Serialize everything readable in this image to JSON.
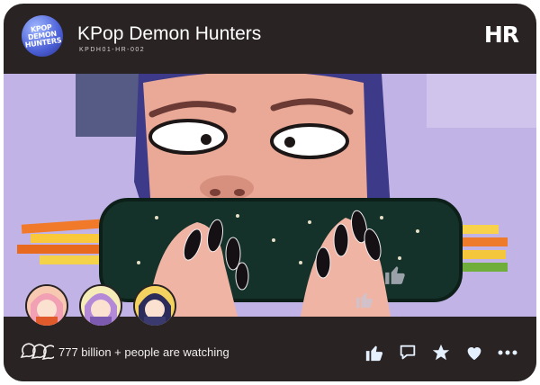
{
  "header": {
    "logo_text": "KPOP DEMON HUNTERS",
    "title": "KPop Demon Hunters",
    "code": "KPDH01-HR-002",
    "badge": "HR"
  },
  "footer": {
    "watching_text": "777 billion + people are watching",
    "actions": [
      "thumbs-up-icon",
      "comment-icon",
      "star-icon",
      "heart-icon",
      "more-icon"
    ]
  },
  "colors": {
    "card_bg": "#2a2323",
    "accent_text": "#ffffff"
  }
}
